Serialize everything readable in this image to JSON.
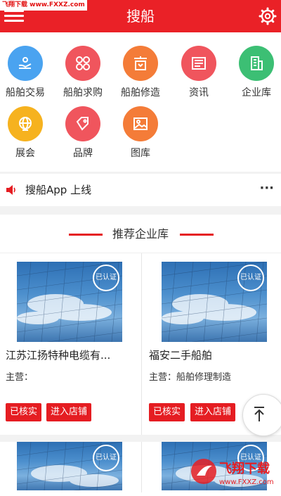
{
  "header": {
    "title": "搜船",
    "watermark": "飞翔下载 www.FXXZ.com"
  },
  "grid": [
    {
      "label": "船舶交易",
      "color": "#4aa3f0",
      "icon": "hand-boat-icon"
    },
    {
      "label": "船舶求购",
      "color": "#f0555d",
      "icon": "flower-icon"
    },
    {
      "label": "船舶修造",
      "color": "#f47c38",
      "icon": "shop-icon"
    },
    {
      "label": "资讯",
      "color": "#f0555d",
      "icon": "news-icon"
    },
    {
      "label": "企业库",
      "color": "#3cbf74",
      "icon": "building-icon"
    },
    {
      "label": "展会",
      "color": "#f6b21f",
      "icon": "globe-icon"
    },
    {
      "label": "品牌",
      "color": "#f0555d",
      "icon": "tag-icon"
    },
    {
      "label": "图库",
      "color": "#f47c38",
      "icon": "image-icon"
    }
  ],
  "notice": {
    "text": "搜船App 上线",
    "more": "···"
  },
  "section": {
    "title": "推荐企业库"
  },
  "cards": [
    {
      "name": "江苏江扬特种电缆有...",
      "main": "主营：",
      "badge": "已认证",
      "btn_verified": "已核实",
      "btn_store": "进入店铺"
    },
    {
      "name": "福安二手船舶",
      "main": "主营：船舶修理制造",
      "badge": "已认证",
      "btn_verified": "已核实",
      "btn_store": "进入店铺"
    },
    {
      "badge": "已认证"
    },
    {
      "badge": "已认证"
    }
  ],
  "logo": {
    "text": "飞翔下载",
    "sub": "www.FXXZ.com"
  }
}
